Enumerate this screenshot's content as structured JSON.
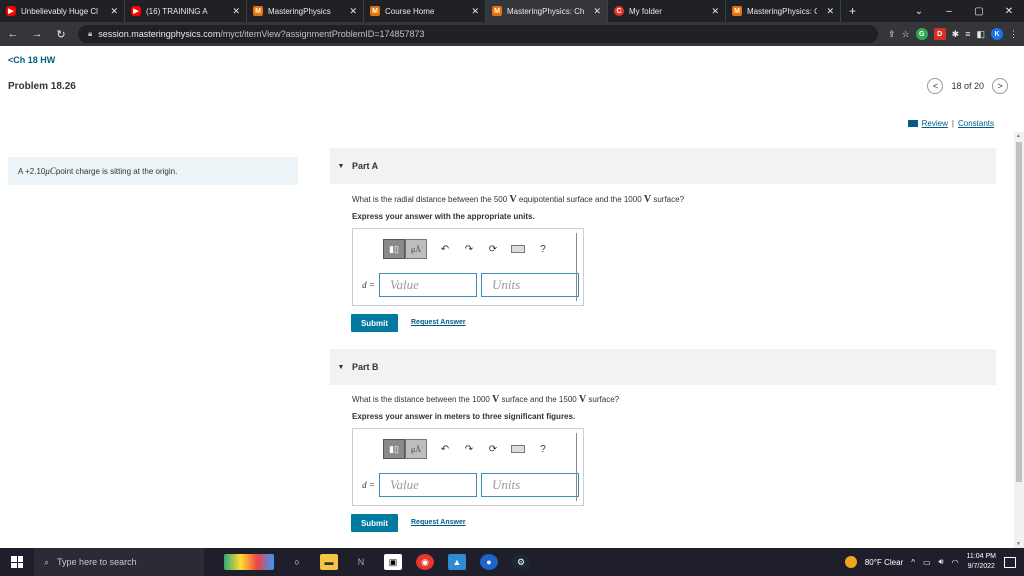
{
  "browser": {
    "tabs": [
      {
        "title": "Unbelievably Huge Cl",
        "icon": "youtube-icon",
        "active": false
      },
      {
        "title": "(16) TRAINING A",
        "icon": "youtube-icon",
        "active": false
      },
      {
        "title": "MasteringPhysics",
        "icon": "mastering-icon",
        "active": false
      },
      {
        "title": "Course Home",
        "icon": "mastering-icon",
        "active": false
      },
      {
        "title": "MasteringPhysics: Ch",
        "icon": "mastering-icon",
        "active": true
      },
      {
        "title": "My folder",
        "icon": "canvas-icon",
        "active": false
      },
      {
        "title": "MasteringPhysics: Ch",
        "icon": "mastering-icon",
        "active": false
      }
    ],
    "url_host": "session.masteringphysics.com",
    "url_path": "/myct/itemView?assignmentProblemID=174857873"
  },
  "page": {
    "breadcrumb": "<Ch 18 HW",
    "problem_title": "Problem 18.26",
    "pager": {
      "current": "18 of 20"
    },
    "links": {
      "review": "Review",
      "separator": "|",
      "constants": "Constants"
    },
    "intro": {
      "pre": "A +2.10 ",
      "unit": "μC",
      "post": " point charge is sitting at the origin."
    },
    "parts": [
      {
        "label": "Part A",
        "question_pre": "What is the radial distance between the 500 ",
        "v1": "V",
        "question_mid": " equipotential surface and the 1000 ",
        "v2": "V",
        "question_post": " surface?",
        "express": "Express your answer with the appropriate units.",
        "variable": "d =",
        "value_placeholder": "Value",
        "units_placeholder": "Units",
        "submit": "Submit",
        "request_answer": "Request Answer"
      },
      {
        "label": "Part B",
        "question_pre": "What is the distance between the 1000 ",
        "v1": "V",
        "question_mid": " surface and the 1500 ",
        "v2": "V",
        "question_post": " surface?",
        "express": "Express your answer in meters to three significant figures.",
        "variable": "d =",
        "value_placeholder": "Value",
        "units_placeholder": "Units",
        "submit": "Submit",
        "request_answer": "Request Answer"
      }
    ],
    "toolbar": {
      "template_glyph": "■▯",
      "mu_glyph": "μÅ",
      "undo": "↶",
      "redo": "↷",
      "reset": "⟳",
      "help": "?"
    }
  },
  "taskbar": {
    "search_placeholder": "Type here to search",
    "weather": "80°F  Clear",
    "time": "11:04 PM",
    "date": "9/7/2022"
  }
}
